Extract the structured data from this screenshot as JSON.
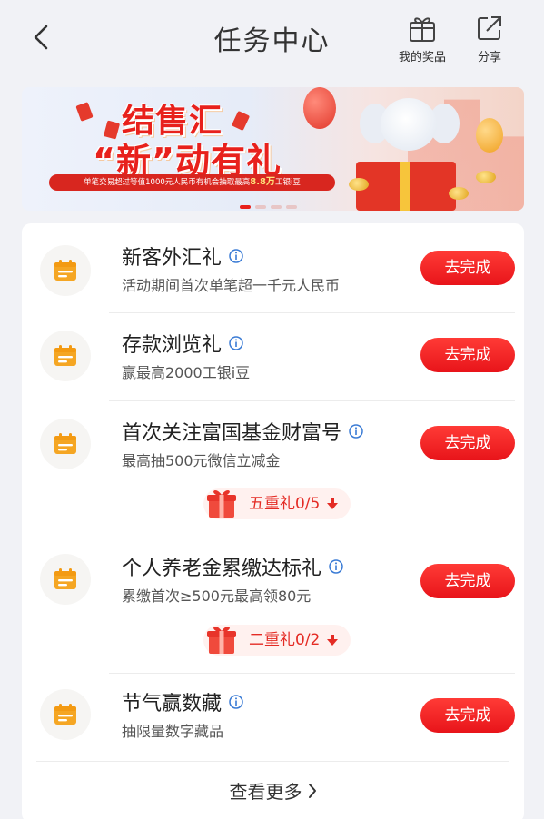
{
  "header": {
    "title": "任务中心",
    "prizes_label": "我的奖品",
    "share_label": "分享"
  },
  "banner": {
    "title_line1": "结售汇",
    "title_line2": "“新”动有礼",
    "subtitle_prefix": "单笔交易超过等值1000元人民币有机会抽取最高",
    "subtitle_highlight": "8.8万",
    "subtitle_suffix": "工银i豆",
    "pager_count": 4,
    "pager_active": 0
  },
  "tasks": [
    {
      "name": "新客外汇礼",
      "desc": "活动期间首次单笔超一千元人民币",
      "action": "去完成"
    },
    {
      "name": "存款浏览礼",
      "desc": "赢最高2000工银i豆",
      "action": "去完成"
    },
    {
      "name": "首次关注富国基金财富号",
      "desc": "最高抽500元微信立减金",
      "action": "去完成",
      "reward": "五重礼0/5"
    },
    {
      "name": "个人养老金累缴达标礼",
      "desc": "累缴首次≥500元最高领80元",
      "action": "去完成",
      "reward": "二重礼0/2"
    },
    {
      "name": "节气赢数藏",
      "desc": "抽限量数字藏品",
      "action": "去完成"
    }
  ],
  "more_label": "查看更多",
  "colors": {
    "accent": "#e8141a",
    "icon_orange": "#f5a623",
    "info_blue": "#3a7bd5",
    "background": "#f1f2f6"
  },
  "icons": {
    "back": "chevron-left-icon",
    "prizes": "gift-icon",
    "share": "share-icon",
    "task": "calendar-icon",
    "info": "info-icon",
    "reward": "gift-box-icon",
    "reward_toggle": "arrow-down-icon",
    "more": "chevron-right-icon"
  }
}
